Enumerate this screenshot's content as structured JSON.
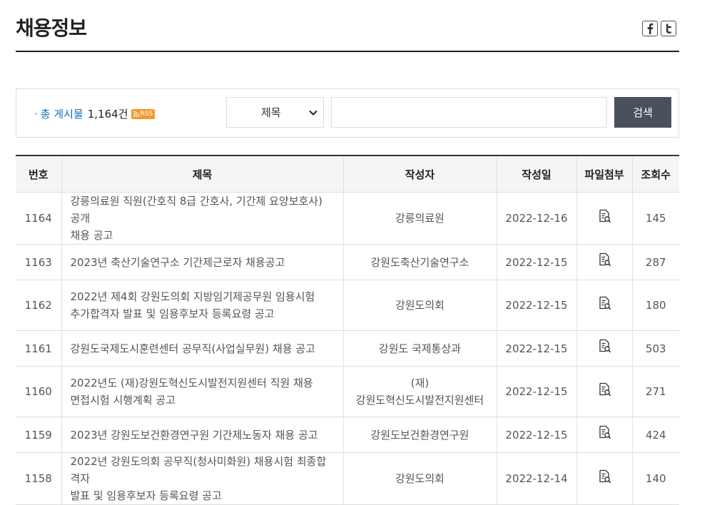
{
  "page": {
    "title": "채용정보"
  },
  "sns": {
    "facebook_icon": "facebook-icon",
    "twitter_icon": "twitter-icon"
  },
  "search": {
    "total_label": "총 게시물",
    "total_count": "1,164건",
    "rss_label": "RSS",
    "field_selected": "제목",
    "keyword_value": "",
    "button_label": "검색"
  },
  "table": {
    "headers": [
      "번호",
      "제목",
      "작성자",
      "작성일",
      "파일첨부",
      "조회수"
    ],
    "rows": [
      {
        "no": "1164",
        "title_line1": "강릉의료원 직원(간호직 8급 간호사, 기간제 요양보호사) 공개",
        "title_line2": "채용 공고",
        "author_line1": "강릉의료원",
        "author_line2": "",
        "date": "2022-12-16",
        "views": "145"
      },
      {
        "no": "1163",
        "title_line1": "2023년 축산기술연구소 기간제근로자 채용공고",
        "title_line2": "",
        "author_line1": "강원도축산기술연구소",
        "author_line2": "",
        "date": "2022-12-15",
        "views": "287"
      },
      {
        "no": "1162",
        "title_line1": "2022년 제4회 강원도의회 지방임기제공무원 임용시험",
        "title_line2": "추가합격자 발표 및 임용후보자 등록요령 공고",
        "author_line1": "강원도의회",
        "author_line2": "",
        "date": "2022-12-15",
        "views": "180"
      },
      {
        "no": "1161",
        "title_line1": "강원도국제도시훈련센터 공무직(사업실무원) 채용 공고",
        "title_line2": "",
        "author_line1": "강원도 국제통상과",
        "author_line2": "",
        "date": "2022-12-15",
        "views": "503"
      },
      {
        "no": "1160",
        "title_line1": "2022년도 (재)강원도혁신도시발전지원센터 직원 채용",
        "title_line2": "면접시험 시행계획 공고",
        "author_line1": "(재)",
        "author_line2": "강원도혁신도시발전지원센터",
        "date": "2022-12-15",
        "views": "271"
      },
      {
        "no": "1159",
        "title_line1": "2023년 강원도보건환경연구원 기간제노동자 채용 공고",
        "title_line2": "",
        "author_line1": "강원도보건환경연구원",
        "author_line2": "",
        "date": "2022-12-15",
        "views": "424"
      },
      {
        "no": "1158",
        "title_line1": "2022년 강원도의회 공무직(청사미화원) 채용시험 최종합격자",
        "title_line2": "발표 및 임용후보자 등록요령 공고",
        "author_line1": "강원도의회",
        "author_line2": "",
        "date": "2022-12-14",
        "views": "140"
      }
    ]
  },
  "colors": {
    "accent_blue": "#1a6fb0",
    "button_bg": "#4b515c",
    "rss_orange": "#f39a2b"
  },
  "icons": {
    "attachment": "attachment-icon",
    "dropdown": "chevron-down-icon"
  }
}
